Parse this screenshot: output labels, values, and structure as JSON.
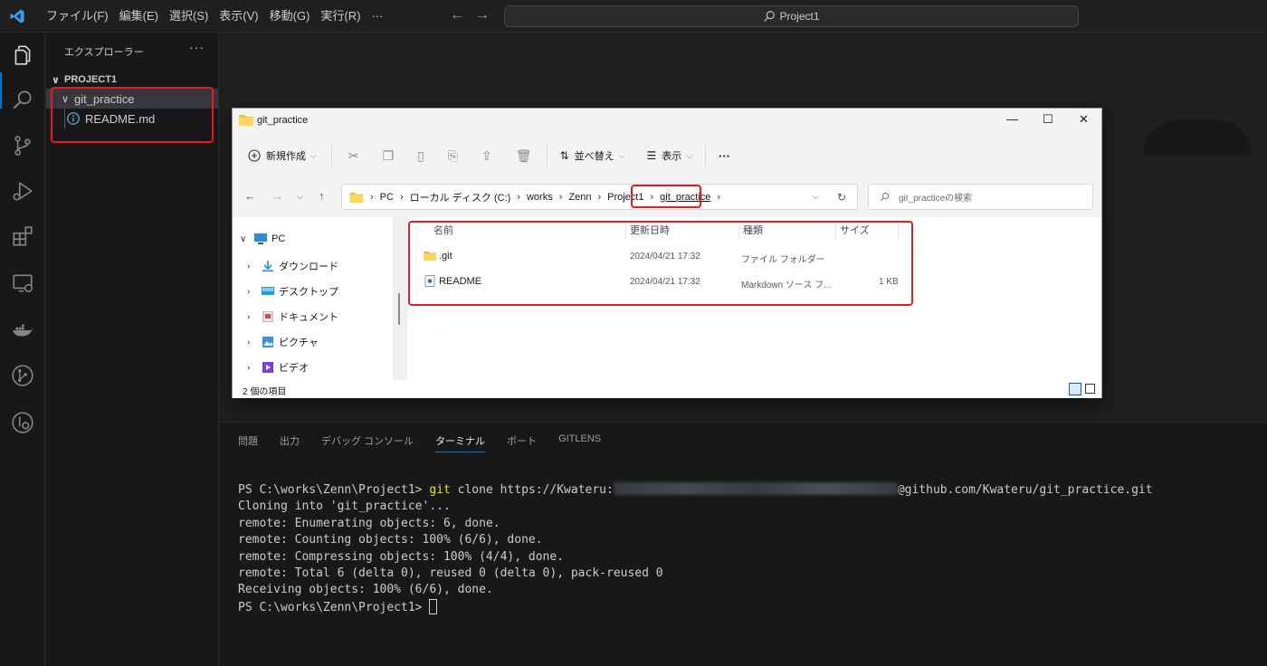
{
  "vscode": {
    "menu": [
      "ファイル(F)",
      "編集(E)",
      "選択(S)",
      "表示(V)",
      "移動(G)",
      "実行(R)",
      "···"
    ],
    "nav_back": "←",
    "nav_forward": "→",
    "command_center": "Project1",
    "accent_color": "#0078d4",
    "activity_icons": [
      "files-icon",
      "search-icon",
      "source-control-icon",
      "run-debug-icon",
      "extensions-icon",
      "remote-explorer-icon",
      "docker-icon",
      "git-graph-icon",
      "gitlens-icon"
    ]
  },
  "sidebar": {
    "title": "エクスプローラー",
    "more": "···",
    "project": "PROJECT1",
    "folder": "git_practice",
    "file": "README.md"
  },
  "panel": {
    "tabs": [
      "問題",
      "出力",
      "デバッグ コンソール",
      "ターミナル",
      "ポート",
      "GITLENS"
    ],
    "active_tab": "ターミナル",
    "terminal": {
      "prompt1": "PS C:\\works\\Zenn\\Project1> ",
      "cmd_git": "git",
      "cmd_rest": " clone https://Kwateru:",
      "cmd_tail": "@github.com/Kwateru/git_practice.git",
      "lines": [
        "Cloning into 'git_practice'...",
        "remote: Enumerating objects: 6, done.",
        "remote: Counting objects: 100% (6/6), done.",
        "remote: Compressing objects: 100% (4/4), done.",
        "remote: Total 6 (delta 0), reused 0 (delta 0), pack-reused 0",
        "Receiving objects: 100% (6/6), done."
      ],
      "prompt2": "PS C:\\works\\Zenn\\Project1> "
    }
  },
  "explorer_window": {
    "title": "git_practice",
    "window_buttons": {
      "minimize": "—",
      "maximize": "☐",
      "close": "✕"
    },
    "toolbar": {
      "new": "新規作成",
      "sort": "並べ替え",
      "view": "表示",
      "more": "···"
    },
    "breadcrumb": [
      "PC",
      "ローカル ディスク (C:)",
      "works",
      "Zenn",
      "Project1",
      "git_practice"
    ],
    "search_placeholder": "git_practiceの検索",
    "nav_items": [
      {
        "label": "PC",
        "icon": "pc-icon"
      },
      {
        "label": "ダウンロード",
        "icon": "download-icon"
      },
      {
        "label": "デスクトップ",
        "icon": "desktop-icon"
      },
      {
        "label": "ドキュメント",
        "icon": "documents-icon"
      },
      {
        "label": "ピクチャ",
        "icon": "pictures-icon"
      },
      {
        "label": "ビデオ",
        "icon": "videos-icon"
      }
    ],
    "columns": [
      "名前",
      "更新日時",
      "種類",
      "サイズ"
    ],
    "files": [
      {
        "name": ".git",
        "modified": "2024/04/21 17:32",
        "type": "ファイル フォルダー",
        "size": ""
      },
      {
        "name": "README",
        "modified": "2024/04/21 17:32",
        "type": "Markdown ソース フ...",
        "size": "1 KB"
      }
    ],
    "status": "2 個の項目"
  }
}
